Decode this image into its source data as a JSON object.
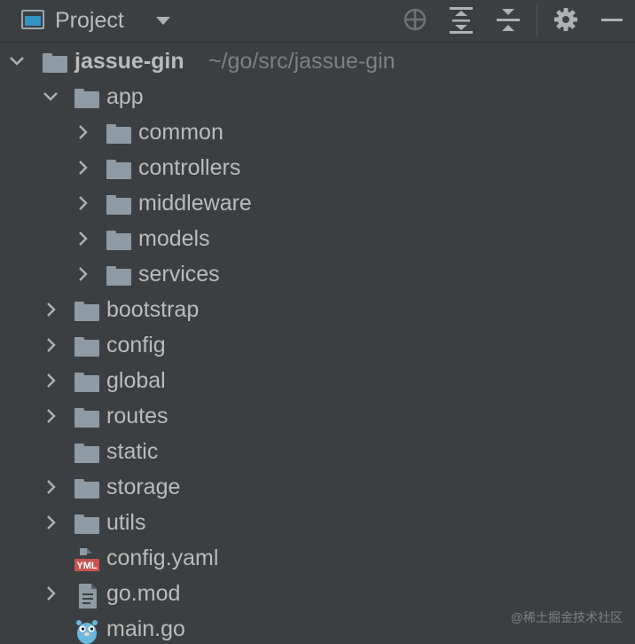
{
  "panel": {
    "title": "Project",
    "title_icon": "project-window-icon",
    "toolbar_icons": [
      "caret-down-icon",
      "crosshair-icon",
      "expand-all-icon",
      "collapse-all-icon",
      "gear-icon",
      "minimize-icon"
    ]
  },
  "root": {
    "name": "jassue-gin",
    "path": "~/go/src/jassue-gin"
  },
  "tree": {
    "app": "app",
    "common": "common",
    "controllers": "controllers",
    "middleware": "middleware",
    "models": "models",
    "services": "services",
    "bootstrap": "bootstrap",
    "config": "config",
    "global": "global",
    "routes": "routes",
    "static": "static",
    "storage": "storage",
    "utils": "utils",
    "config_yaml": "config.yaml",
    "go_mod": "go.mod",
    "main_go": "main.go"
  },
  "yaml_badge": "YML",
  "watermark": "@稀土掘金技术社区",
  "colors": {
    "background": "#3c3f41",
    "text": "#bbbbbb",
    "path": "#808080",
    "folder": "#8e9aa4",
    "accent": "#3592c4"
  }
}
